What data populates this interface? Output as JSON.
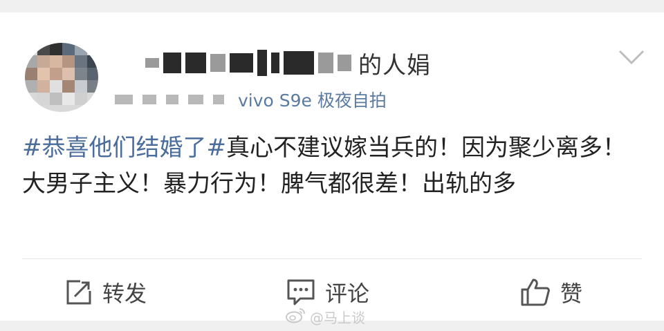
{
  "post": {
    "username_visible": "的人娟",
    "device": "vivo S9e 极夜自拍",
    "content": {
      "topic": "#恭喜他们结婚了#",
      "text": "真心不建议嫁当兵的！因为聚少离多！大男子主义！暴力行为！脾气都很差！出轨的多"
    },
    "more_icon": "chevron-down-icon"
  },
  "actions": {
    "repost": {
      "label": "转发",
      "icon": "share-icon"
    },
    "comment": {
      "label": "评论",
      "icon": "comment-icon"
    },
    "like": {
      "label": "赞",
      "icon": "thumbs-up-icon"
    }
  },
  "watermark": {
    "text": "@马上谈",
    "icon": "weibo-icon"
  },
  "colors": {
    "topic": "#4a6d9c",
    "device": "#5a7aa0",
    "text": "#222222",
    "background": "#f0f0f0"
  }
}
